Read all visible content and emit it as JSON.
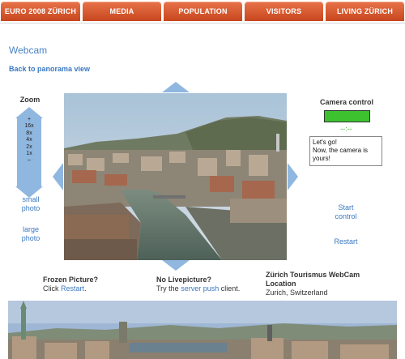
{
  "nav": {
    "tabs": [
      "EURO 2008 ZÜRICH",
      "MEDIA",
      "POPULATION",
      "VISITORS",
      "LIVING ZÜRICH"
    ]
  },
  "page": {
    "title": "Webcam",
    "back_link": "Back to panorama view"
  },
  "zoom": {
    "label": "Zoom",
    "levels": [
      "+",
      "16x",
      "8x",
      "4x",
      "2x",
      "1x",
      "–"
    ]
  },
  "left_links": {
    "small_photo": [
      "small",
      "photo"
    ],
    "large_photo": [
      "large",
      "photo"
    ]
  },
  "camera": {
    "label": "Camera control",
    "status_indicator": "--:--",
    "message_line1": "Let's go!",
    "message_line2": "Now, the camera is yours!",
    "start_control": [
      "Start",
      "control"
    ],
    "restart": "Restart"
  },
  "info": {
    "frozen_title": "Frozen Picture?",
    "frozen_prefix": "Click",
    "frozen_link": "Restart",
    "frozen_suffix": ".",
    "nolive_title": "No Livepicture?",
    "nolive_prefix": "Try the",
    "nolive_link": "server push",
    "nolive_suffix": "client.",
    "location_title_line1": "Zürich Tourismus WebCam",
    "location_title_line2": "Location",
    "location": "Zurich, Switzerland"
  },
  "colors": {
    "tab_orange": "#d9592b",
    "link_blue": "#3a78c0",
    "arrow_blue": "#8fb7e0",
    "camera_green": "#3dc12f"
  }
}
